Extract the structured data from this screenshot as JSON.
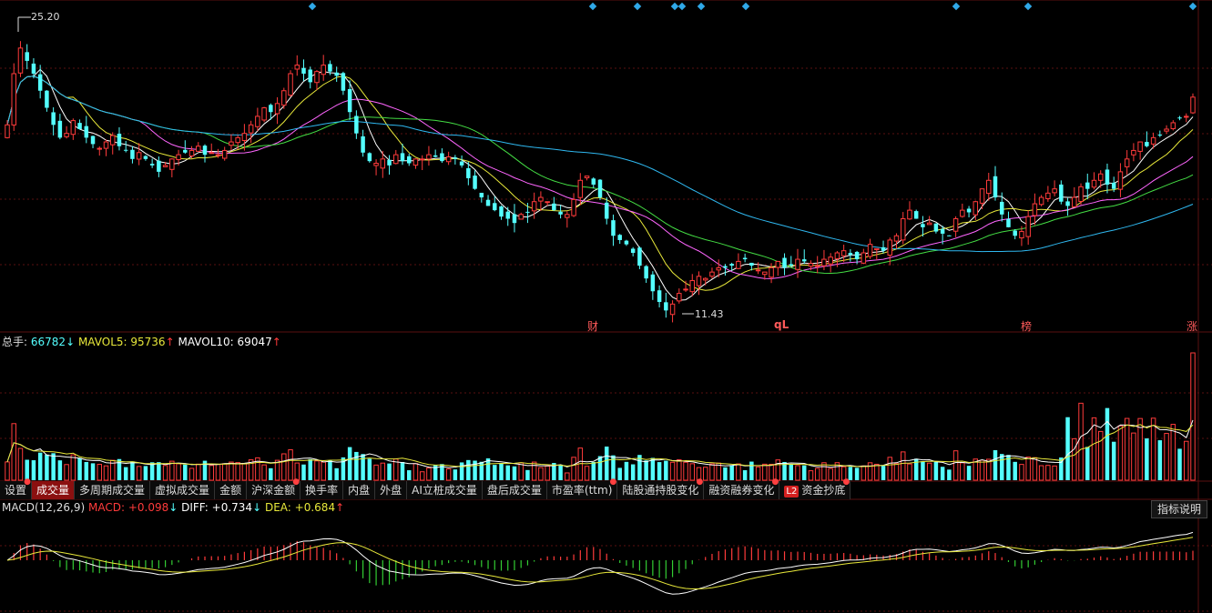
{
  "price": {
    "high_label": "25.20",
    "low_label": "11.43"
  },
  "event_markers": [
    "财",
    "qL",
    "榜",
    "涨"
  ],
  "volume_legend": {
    "total_label": "总手:",
    "total_value": "66782",
    "total_arrow": "↓",
    "ma5_label": "MAVOL5:",
    "ma5_value": "95736",
    "ma5_arrow": "↑",
    "ma10_label": "MAVOL10:",
    "ma10_value": "69047",
    "ma10_arrow": "↑"
  },
  "tabs": [
    {
      "label": "设置",
      "dot": true
    },
    {
      "label": "成交量",
      "active": true
    },
    {
      "label": "多周期成交量"
    },
    {
      "label": "虚拟成交量"
    },
    {
      "label": "金额"
    },
    {
      "label": "沪深金额",
      "dot": true
    },
    {
      "label": "换手率"
    },
    {
      "label": "内盘"
    },
    {
      "label": "外盘"
    },
    {
      "label": "AI立桩成交量"
    },
    {
      "label": "盘后成交量"
    },
    {
      "label": "市盈率(ttm)",
      "dot": true
    },
    {
      "label": "陆股通持股变化",
      "dot": true
    },
    {
      "label": "融资融券变化",
      "dot": true
    },
    {
      "label": "资金抄底",
      "badge": "L2",
      "dot": true
    }
  ],
  "macd_legend": {
    "name": "MACD(12,26,9)",
    "macd_label": "MACD:",
    "macd_value": "+0.098",
    "macd_arrow": "↓",
    "diff_label": "DIFF:",
    "diff_value": "+0.734",
    "diff_arrow": "↓",
    "dea_label": "DEA:",
    "dea_value": "+0.684",
    "dea_arrow": "↑"
  },
  "help_button": "指标说明",
  "colors": {
    "up": "#ff3b3b",
    "down": "#54ffff",
    "ma5": "#ffffff",
    "ma10": "#e8e83a",
    "ma20": "#ff66ff",
    "ma30": "#44dd44",
    "ma60": "#2fb8f0",
    "grid": "#5a1010",
    "diamond": "#2fa8e8"
  },
  "chart_data": {
    "type": "candlestick",
    "price_range": [
      11.43,
      25.2
    ],
    "close": [
      20.2,
      22.6,
      23.8,
      23.2,
      22.6,
      21.8,
      21.0,
      20.2,
      19.6,
      19.8,
      20.4,
      20.0,
      19.6,
      19.3,
      19.1,
      19.4,
      19.7,
      19.2,
      19.0,
      18.6,
      18.9,
      18.6,
      18.3,
      18.0,
      18.3,
      18.6,
      18.8,
      18.9,
      19.0,
      19.2,
      18.8,
      18.9,
      18.8,
      19.0,
      19.4,
      19.6,
      19.8,
      20.2,
      20.6,
      21.0,
      20.8,
      21.2,
      21.8,
      22.6,
      23.0,
      22.6,
      22.2,
      22.7,
      23.0,
      22.7,
      22.5,
      21.8,
      20.8,
      19.8,
      18.9,
      18.5,
      18.4,
      18.6,
      18.3,
      18.8,
      18.5,
      18.4,
      18.6,
      18.6,
      18.8,
      18.7,
      18.5,
      18.7,
      18.6,
      18.3,
      17.7,
      17.2,
      16.8,
      16.4,
      16.2,
      15.9,
      15.8,
      15.6,
      16.0,
      16.1,
      16.6,
      16.8,
      16.6,
      16.2,
      16.0,
      16.0,
      16.7,
      17.6,
      17.8,
      17.4,
      16.8,
      15.8,
      15.0,
      14.8,
      14.6,
      14.2,
      13.6,
      13.0,
      12.4,
      11.9,
      11.5,
      11.8,
      12.3,
      12.5,
      12.9,
      13.1,
      13.0,
      13.3,
      13.5,
      13.5,
      13.6,
      13.8,
      13.9,
      13.6,
      13.4,
      13.3,
      13.5,
      13.8,
      13.5,
      13.6,
      13.9,
      13.8,
      13.7,
      13.6,
      13.9,
      14.0,
      14.2,
      14.3,
      14.1,
      13.9,
      14.2,
      14.6,
      14.4,
      14.3,
      14.8,
      15.0,
      15.8,
      16.2,
      15.8,
      15.4,
      15.6,
      15.2,
      15.1,
      15.0,
      15.8,
      16.2,
      16.1,
      16.6,
      17.2,
      17.6,
      16.8,
      16.0,
      15.4,
      15.0,
      15.2,
      15.9,
      16.5,
      16.8,
      17.0,
      17.2,
      16.6,
      16.4,
      16.8,
      17.3,
      17.2,
      17.6,
      17.9,
      17.4,
      17.2,
      18.0,
      18.6,
      19.0,
      19.4,
      19.2,
      19.6,
      19.7,
      20.0,
      20.3,
      20.5,
      20.6,
      21.5
    ],
    "ma_periods": [
      5,
      10,
      20,
      30,
      60
    ],
    "volume_note": "volume bars below, red = up day, cyan = down day",
    "macd_params": [
      12,
      26,
      9
    ]
  }
}
